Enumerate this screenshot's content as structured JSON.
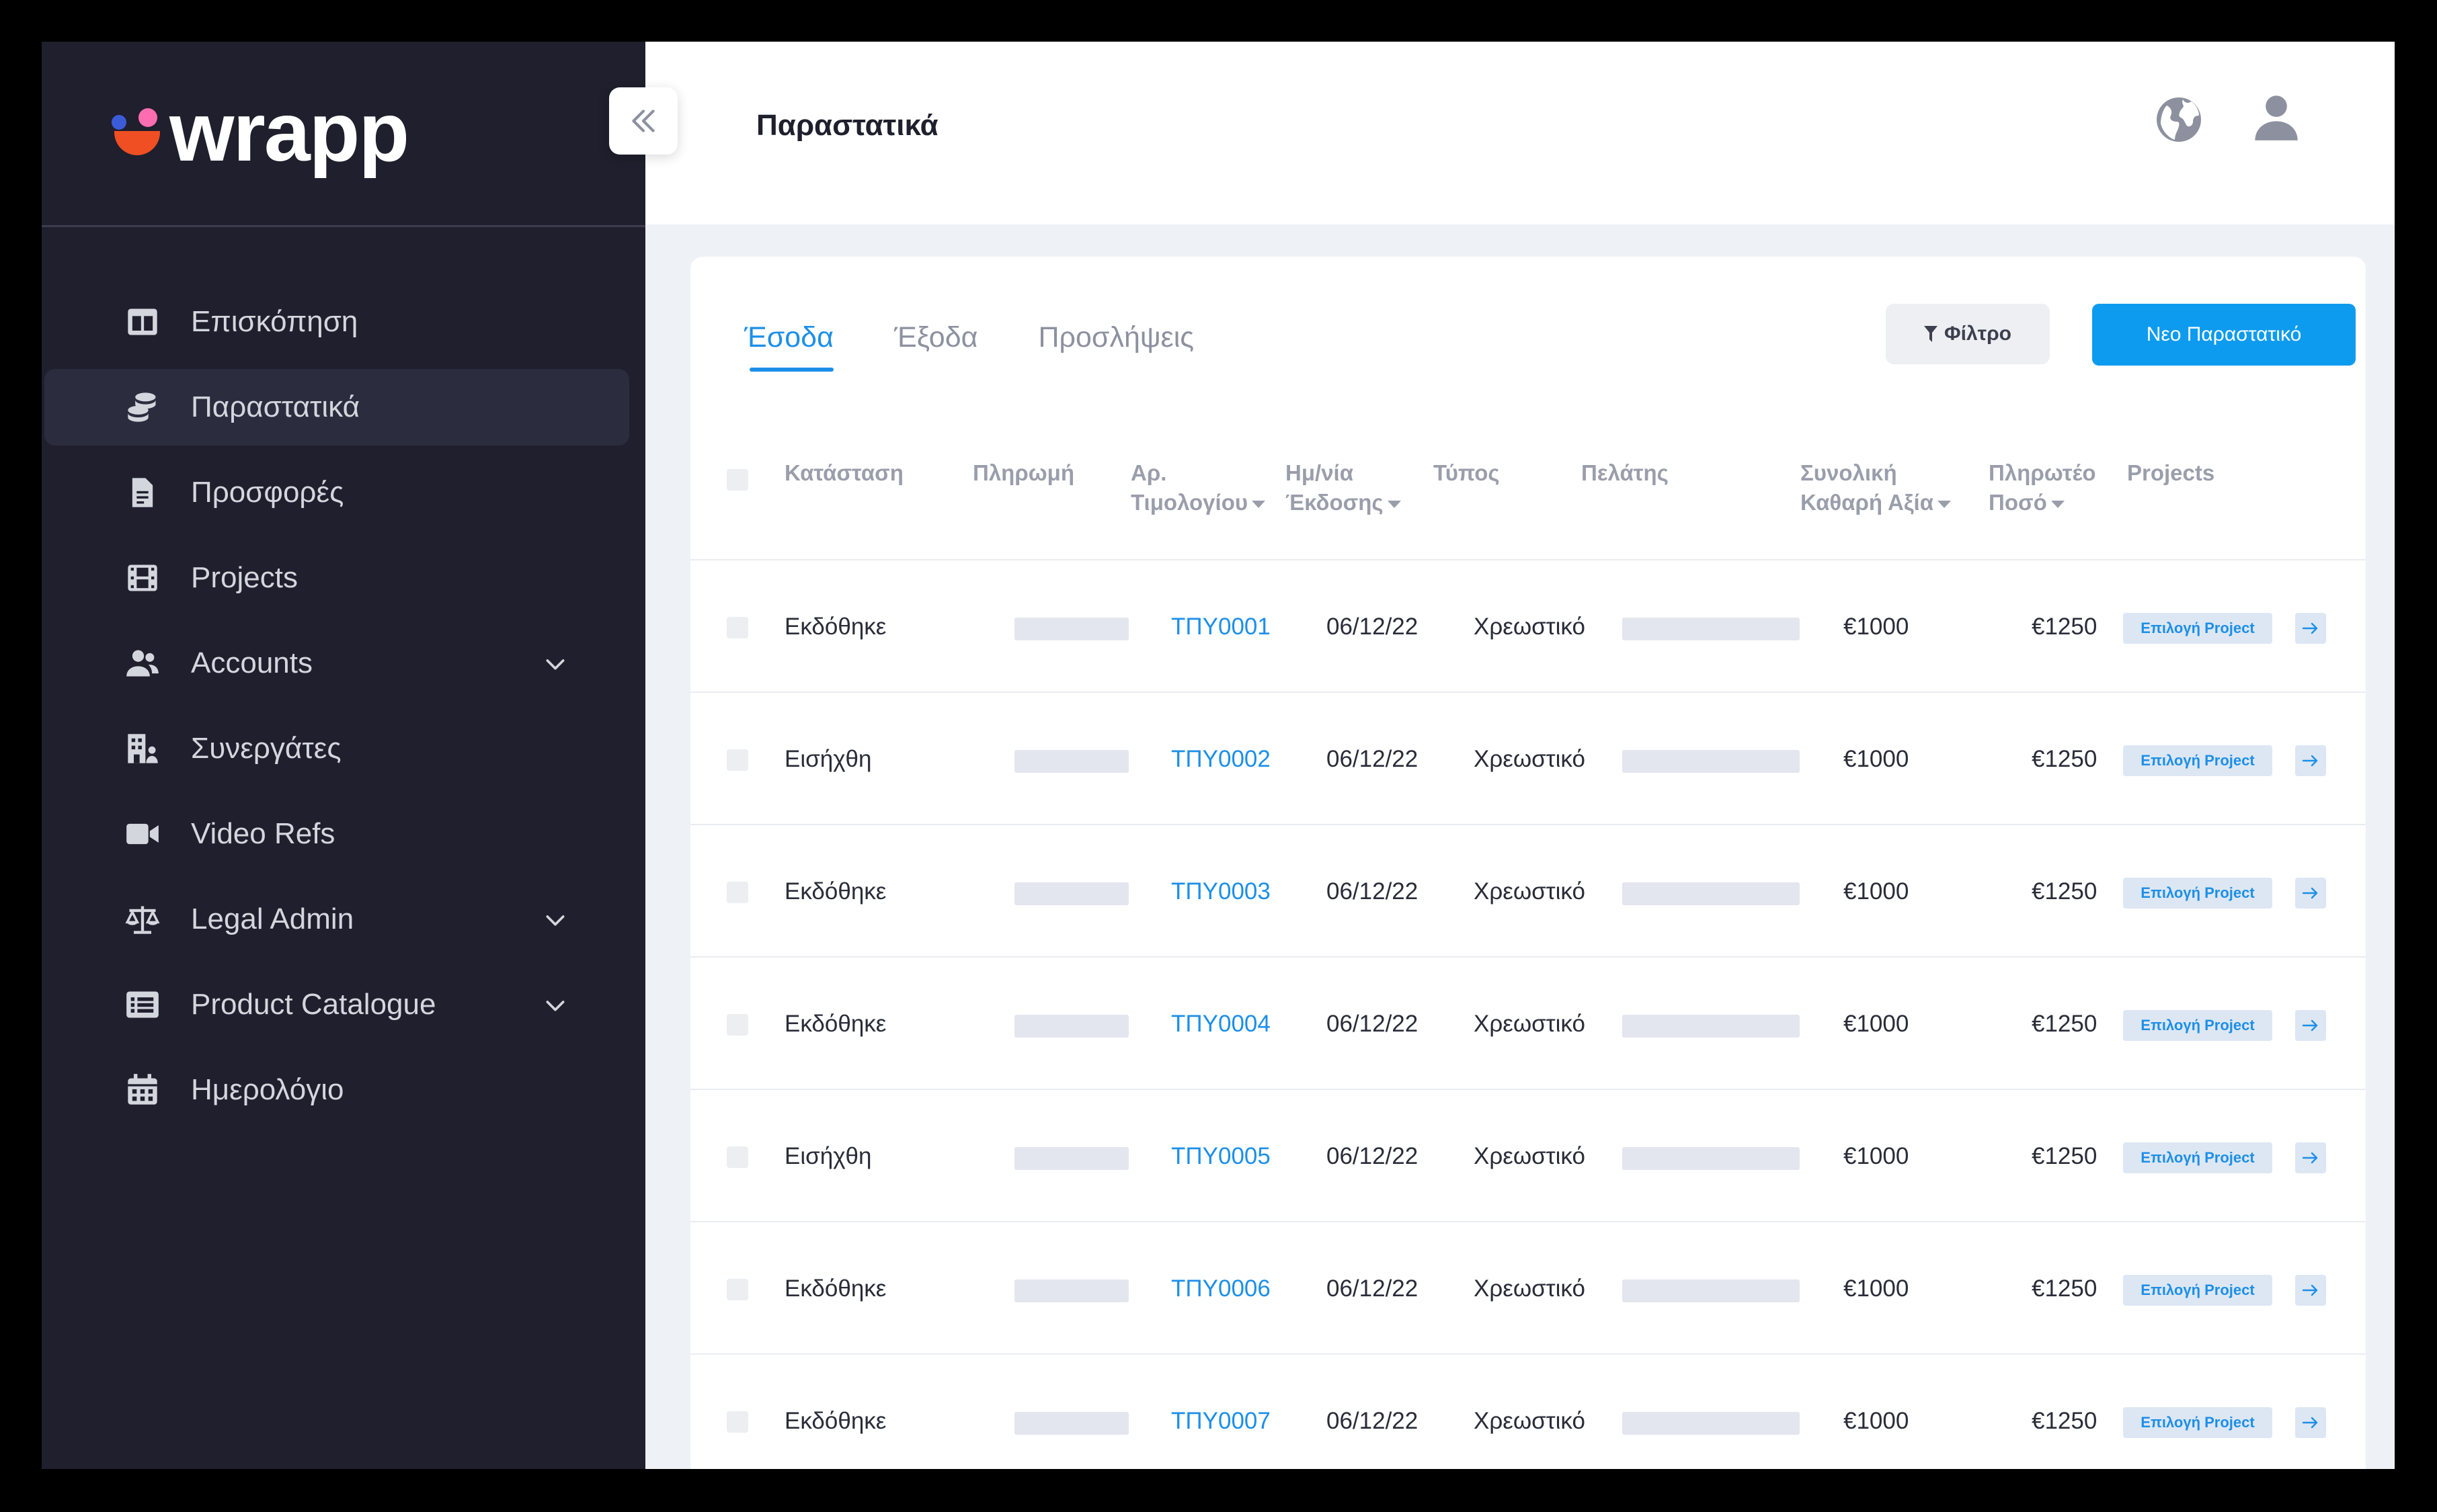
{
  "app": {
    "logo_text": "wrapp",
    "colors": {
      "accent": "#0d9bf0",
      "sidebar_bg": "#1f1f2d",
      "link": "#1c8fe8",
      "logo_orange": "#f04e23",
      "logo_pink": "#ff6db0",
      "logo_blue": "#3c5bd9"
    }
  },
  "header": {
    "title": "Παραστατικά",
    "icons": [
      "globe-icon",
      "user-icon"
    ],
    "collapse_icon": "double-chevron-left-icon"
  },
  "sidebar": {
    "items": [
      {
        "label": "Επισκόπηση",
        "icon": "layout-icon",
        "active": false,
        "expandable": false
      },
      {
        "label": "Παραστατικά",
        "icon": "coins-icon",
        "active": true,
        "expandable": false
      },
      {
        "label": "Προσφορές",
        "icon": "document-icon",
        "active": false,
        "expandable": false
      },
      {
        "label": "Projects",
        "icon": "film-icon",
        "active": false,
        "expandable": false
      },
      {
        "label": "Accounts",
        "icon": "users-icon",
        "active": false,
        "expandable": true
      },
      {
        "label": "Συνεργάτες",
        "icon": "building-icon",
        "active": false,
        "expandable": false
      },
      {
        "label": "Video Refs",
        "icon": "video-camera-icon",
        "active": false,
        "expandable": false
      },
      {
        "label": "Legal Admin",
        "icon": "scale-icon",
        "active": false,
        "expandable": true
      },
      {
        "label": "Product Catalogue",
        "icon": "list-icon",
        "active": false,
        "expandable": true
      },
      {
        "label": "Ημερολόγιο",
        "icon": "calendar-icon",
        "active": false,
        "expandable": false
      }
    ]
  },
  "main": {
    "tabs": [
      {
        "label": "Έσοδα",
        "active": true
      },
      {
        "label": "Έξοδα",
        "active": false
      },
      {
        "label": "Προσλήψεις",
        "active": false
      }
    ],
    "filter_label": "Φίλτρο",
    "new_button_label": "Νεο Παραστατικό",
    "table": {
      "headers": {
        "status": "Κατάσταση",
        "payment": "Πληρωμή",
        "invoice_no_1": "Αρ.",
        "invoice_no_2": "Τιμολογίου",
        "issue_date_1": "Ημ/νία",
        "issue_date_2": "Έκδοσης",
        "type": "Τύπος",
        "client": "Πελάτης",
        "net_total_1": "Συνολική",
        "net_total_2": "Καθαρή Αξία",
        "payable_1": "Πληρωτέο",
        "payable_2": "Ποσό",
        "projects": "Projects"
      },
      "rows": [
        {
          "status": "Εκδόθηκε",
          "invoice": "ΤΠΥ0001",
          "date": "06/12/22",
          "type": "Χρεωστικό",
          "net": "€1000",
          "payable": "€1250",
          "project_label": "Επιλογή Project"
        },
        {
          "status": "Εισήχθη",
          "invoice": "ΤΠΥ0002",
          "date": "06/12/22",
          "type": "Χρεωστικό",
          "net": "€1000",
          "payable": "€1250",
          "project_label": "Επιλογή Project"
        },
        {
          "status": "Εκδόθηκε",
          "invoice": "ΤΠΥ0003",
          "date": "06/12/22",
          "type": "Χρεωστικό",
          "net": "€1000",
          "payable": "€1250",
          "project_label": "Επιλογή Project"
        },
        {
          "status": "Εκδόθηκε",
          "invoice": "ΤΠΥ0004",
          "date": "06/12/22",
          "type": "Χρεωστικό",
          "net": "€1000",
          "payable": "€1250",
          "project_label": "Επιλογή Project"
        },
        {
          "status": "Εισήχθη",
          "invoice": "ΤΠΥ0005",
          "date": "06/12/22",
          "type": "Χρεωστικό",
          "net": "€1000",
          "payable": "€1250",
          "project_label": "Επιλογή Project"
        },
        {
          "status": "Εκδόθηκε",
          "invoice": "ΤΠΥ0006",
          "date": "06/12/22",
          "type": "Χρεωστικό",
          "net": "€1000",
          "payable": "€1250",
          "project_label": "Επιλογή Project"
        },
        {
          "status": "Εκδόθηκε",
          "invoice": "ΤΠΥ0007",
          "date": "06/12/22",
          "type": "Χρεωστικό",
          "net": "€1000",
          "payable": "€1250",
          "project_label": "Επιλογή Project"
        }
      ]
    }
  }
}
